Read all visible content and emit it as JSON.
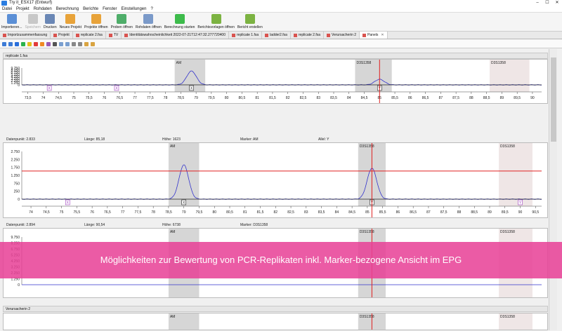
{
  "window": {
    "title": "Try it_ESX17 (Entwurf)",
    "minimize": "–",
    "maximize": "☐",
    "close": "✕"
  },
  "menu": [
    "Datei",
    "Projekt",
    "Rohdaten",
    "Berechnung",
    "Berichte",
    "Fenster",
    "Einstellungen",
    "?"
  ],
  "toolbar": [
    {
      "label": "Importieren...",
      "color": "#5b8fd6",
      "enabled": true
    },
    {
      "label": "Speichern",
      "color": "#c8c8c8",
      "enabled": false
    },
    {
      "label": "Drucken",
      "color": "#6a87b5",
      "enabled": true
    },
    {
      "label": "Neues Projekt",
      "color": "#e8a33a",
      "enabled": true
    },
    {
      "label": "Projekte öffnen",
      "color": "#e8a33a",
      "enabled": true
    },
    {
      "label": "Proben öffnen",
      "color": "#4fae6a",
      "enabled": true
    },
    {
      "label": "Rohdaten öffnen",
      "color": "#7b9ac9",
      "enabled": true
    },
    {
      "label": "Berechnung starten",
      "color": "#3dbb4b",
      "enabled": true
    },
    {
      "label": "Berichtsvorlagen öffnen",
      "color": "#7cb342",
      "enabled": true
    },
    {
      "label": "Bericht erstellen",
      "color": "#7cb342",
      "enabled": true
    }
  ],
  "tabs": [
    {
      "label": "Importzusammenfassung",
      "active": false
    },
    {
      "label": "Projekt",
      "active": false
    },
    {
      "label": "replicate 2.fsa",
      "active": false
    },
    {
      "label": "TV",
      "active": false
    },
    {
      "label": "Identitätswahrscheinlichkeit 2022-07-21T12:47:32.277720400",
      "active": false
    },
    {
      "label": "replicate 1.fsa",
      "active": false
    },
    {
      "label": "ladder2.fsa",
      "active": false
    },
    {
      "label": "replicate 2.fsa",
      "active": false
    },
    {
      "label": "Verursacherin 2",
      "active": false
    },
    {
      "label": "Panels",
      "active": true
    }
  ],
  "panels": [
    {
      "header": "replicate 1.fsa",
      "info": null,
      "yticks": [
        "9.750",
        "8.250",
        "6.750",
        "5.250",
        "4.250",
        "3.250",
        "2.250",
        "1.250",
        "0"
      ],
      "xticks": [
        "73,5",
        "74",
        "74,5",
        "75",
        "75,5",
        "76",
        "76,5",
        "77",
        "77,5",
        "78",
        "78,5",
        "79",
        "79,5",
        "80",
        "80,5",
        "81",
        "81,5",
        "82",
        "82,5",
        "83",
        "83,5",
        "84",
        "84,5",
        "85",
        "85,5",
        "86",
        "86,5",
        "87",
        "87,5",
        "88",
        "88,5",
        "89",
        "89,5",
        "90"
      ],
      "markers": [
        {
          "label": "AM",
          "from": 78.3,
          "to": 79.3
        },
        {
          "label": "D3S1358",
          "from": 84.2,
          "to": 85.4
        }
      ],
      "grey_box": {
        "label": "D3S1358",
        "from": 88.6,
        "to": 89.9
      },
      "peaks": [
        {
          "x": 78.85,
          "height": 0.82
        },
        {
          "x": 85.0,
          "height": 0.33
        }
      ],
      "allele_boxes": [
        {
          "x": 74.2,
          "label": "X"
        },
        {
          "x": 76.4,
          "label": "X"
        },
        {
          "x": 78.85,
          "label": "X"
        },
        {
          "x": 85.0,
          "label": "Y"
        }
      ],
      "redline_x": 85.0
    },
    {
      "header": "",
      "info": {
        "datenpunkt": "Datenpunkt: 2.833",
        "laenge": "Länge: 85,18",
        "hoehe": "Höhe: 1623",
        "marker": "Marker: AM",
        "allel": "Allel: Y"
      },
      "yticks": [
        "2.750",
        "2.250",
        "1.750",
        "1.250",
        "750",
        "250",
        "0"
      ],
      "xticks": [
        "74",
        "74,5",
        "75",
        "75,5",
        "76",
        "76,5",
        "77",
        "77,5",
        "78",
        "78,5",
        "79",
        "79,5",
        "80",
        "80,5",
        "81",
        "81,5",
        "82",
        "82,5",
        "83",
        "83,5",
        "84",
        "84,5",
        "85",
        "85,5",
        "86",
        "86,5",
        "87",
        "87,5",
        "88",
        "88,5",
        "89",
        "89,5",
        "90",
        "90,5"
      ],
      "markers": [
        {
          "label": "AM",
          "from": 78.5,
          "to": 79.5
        },
        {
          "label": "D3S1358",
          "from": 84.7,
          "to": 85.6
        }
      ],
      "grey_box": {
        "label": "D3S1358",
        "from": 89.3,
        "to": 90.4
      },
      "peaks": [
        {
          "x": 79.0,
          "height": 0.72
        },
        {
          "x": 85.15,
          "height": 0.65
        }
      ],
      "allele_boxes": [
        {
          "x": 75.2,
          "label": "X"
        },
        {
          "x": 79.0,
          "label": "X"
        },
        {
          "x": 85.15,
          "label": "Y"
        },
        {
          "x": 90.0,
          "label": "Y"
        }
      ],
      "redline_x": 85.15,
      "hline": 1623
    },
    {
      "header": "",
      "info": {
        "datenpunkt": "Datenpunkt: 2.894",
        "laenge": "Länge: 90,54",
        "hoehe": "Höhe: 6738",
        "marker": "Marker: D3S1358",
        "allel": ""
      },
      "yticks": [
        "9.750",
        "8.250",
        "6.750",
        "5.250",
        "4.250",
        "3.250",
        "2.250",
        "1.250",
        "0"
      ],
      "xticks": [],
      "markers": [
        {
          "label": "AM",
          "from": 78.5,
          "to": 79.5
        },
        {
          "label": "D3S1358",
          "from": 84.7,
          "to": 85.6
        }
      ],
      "grey_box": {
        "label": "D3S1358",
        "from": 89.3,
        "to": 90.4
      },
      "peaks": [],
      "allele_boxes": [],
      "redline_x": 85.15
    },
    {
      "header": "Verursacherin 2",
      "info": null,
      "yticks": [],
      "xticks": [],
      "markers": [
        {
          "label": "AM",
          "from": 78.5,
          "to": 79.5
        },
        {
          "label": "D3S1358",
          "from": 84.7,
          "to": 85.6
        }
      ],
      "grey_box": {
        "label": "D3S1358",
        "from": 89.3,
        "to": 90.4
      },
      "peaks": [],
      "allele_boxes": [],
      "redline_x": 85.15
    }
  ],
  "banner": "Möglichkeiten zur Bewertung von PCR-Replikaten inkl. Marker-bezogene Ansicht im EPG"
}
